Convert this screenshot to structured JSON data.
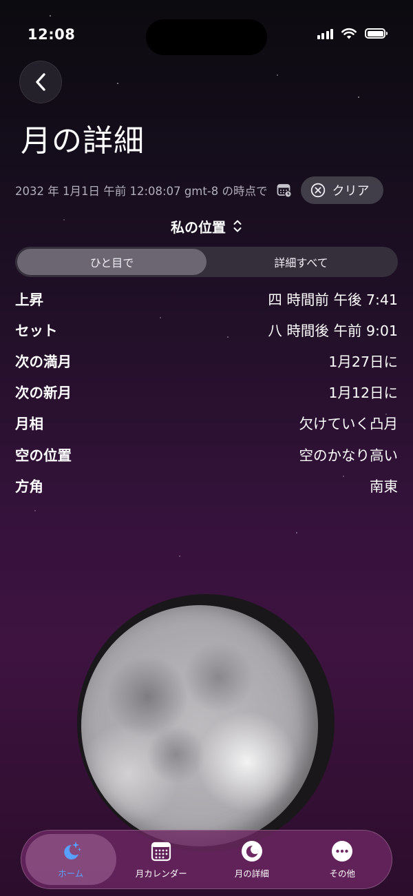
{
  "status_bar": {
    "time": "12:08"
  },
  "header": {
    "title": "月の詳細"
  },
  "timestamp_row": {
    "text": "2032 年 1月1日 午前 12:08:07 gmt-8 の時点で",
    "clear_label": "クリア"
  },
  "location": {
    "label": "私の位置"
  },
  "segments": {
    "glance": "ひと目で",
    "all_details": "詳細すべて",
    "selected": "ひと目で"
  },
  "info": [
    {
      "label": "上昇",
      "value": "四 時間前 午後 7:41"
    },
    {
      "label": "セット",
      "value": "八 時間後 午前 9:01"
    },
    {
      "label": "次の満月",
      "value": "1月27日に"
    },
    {
      "label": "次の新月",
      "value": "1月12日に"
    },
    {
      "label": "月相",
      "value": "欠けていく凸月"
    },
    {
      "label": "空の位置",
      "value": "空のかなり高い"
    },
    {
      "label": "方角",
      "value": "南東"
    }
  ],
  "tabs": [
    {
      "label": "ホーム",
      "icon": "moon-stars-icon",
      "active": true
    },
    {
      "label": "月カレンダー",
      "icon": "calendar-grid-icon",
      "active": false
    },
    {
      "label": "月の詳細",
      "icon": "moon-circle-icon",
      "active": false
    },
    {
      "label": "その他",
      "icon": "more-icon",
      "active": false
    }
  ],
  "colors": {
    "accent_active_tab": "#5aa0ff",
    "tab_bar": "#6e2864",
    "secondary_text": "#b2aebb"
  }
}
